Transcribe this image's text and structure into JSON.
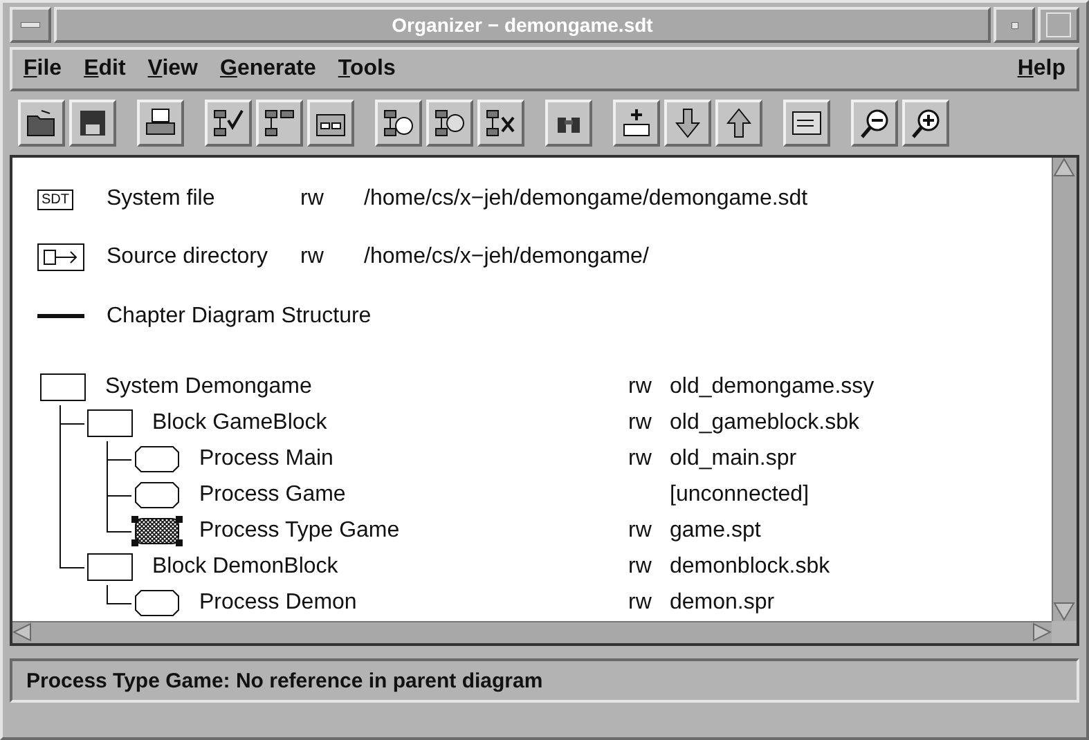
{
  "window": {
    "title": "Organizer − demongame.sdt"
  },
  "menu": [
    {
      "label": "File"
    },
    {
      "label": "Edit"
    },
    {
      "label": "View"
    },
    {
      "label": "Generate"
    },
    {
      "label": "Tools"
    },
    {
      "label": "Help"
    }
  ],
  "header_rows": [
    {
      "kind": "system_file",
      "icon_text": "SDT",
      "label": "System file",
      "access": "rw",
      "path": "/home/cs/x−jeh/demongame/demongame.sdt"
    },
    {
      "kind": "source_dir",
      "label": "Source directory",
      "access": "rw",
      "path": "/home/cs/x−jeh/demongame/"
    },
    {
      "kind": "chapter",
      "label": "Chapter Diagram Structure"
    }
  ],
  "tree": [
    {
      "kind": "system",
      "label": "System Demongame",
      "access": "rw",
      "file": "old_demongame.ssy",
      "selected": false,
      "children": [
        {
          "kind": "block",
          "label": "Block GameBlock",
          "access": "rw",
          "file": "old_gameblock.sbk",
          "selected": false,
          "children": [
            {
              "kind": "process",
              "label": "Process Main",
              "access": "rw",
              "file": "old_main.spr",
              "selected": false
            },
            {
              "kind": "process",
              "label": "Process Game",
              "file": "[unconnected]",
              "selected": false
            },
            {
              "kind": "process_type",
              "label": "Process Type Game",
              "access": "rw",
              "file": "game.spt",
              "selected": true
            }
          ]
        },
        {
          "kind": "block",
          "label": "Block DemonBlock",
          "access": "rw",
          "file": "demonblock.sbk",
          "selected": false,
          "children": [
            {
              "kind": "process",
              "label": "Process Demon",
              "access": "rw",
              "file": "demon.spr",
              "selected": false
            }
          ]
        }
      ]
    }
  ],
  "status_bar": "Process Type Game: No reference in parent diagram"
}
